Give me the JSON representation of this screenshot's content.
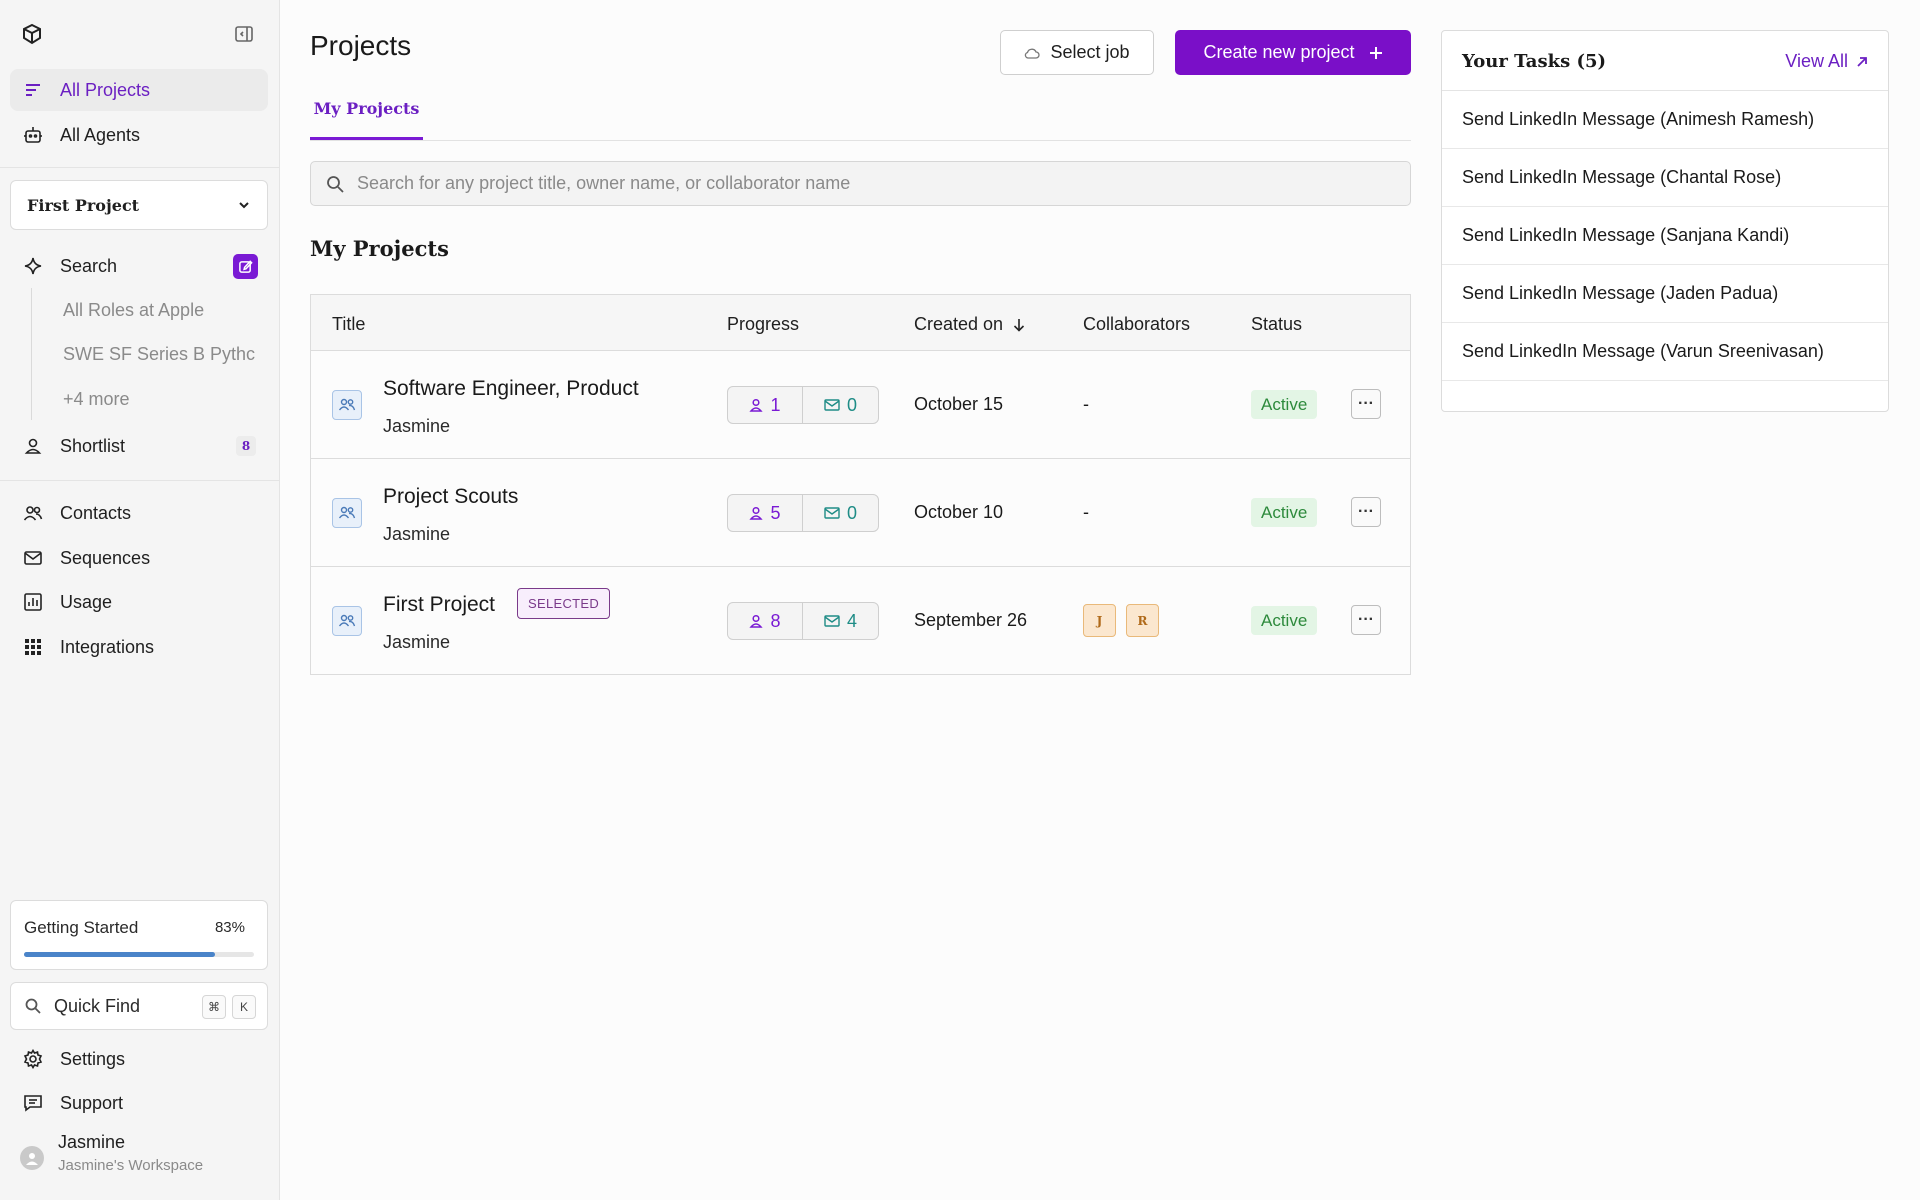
{
  "sidebar": {
    "nav_top": [
      {
        "label": "All Projects",
        "icon": "list-icon"
      },
      {
        "label": "All Agents",
        "icon": "robot-icon"
      }
    ],
    "project_select": "First Project",
    "search_label": "Search",
    "search_subitems": [
      "All Roles at Apple",
      "SWE SF Series B Pythc",
      "+4 more"
    ],
    "shortlist_label": "Shortlist",
    "shortlist_count": "8",
    "nav_mid": [
      {
        "label": "Contacts",
        "icon": "contacts-icon"
      },
      {
        "label": "Sequences",
        "icon": "mail-icon"
      },
      {
        "label": "Usage",
        "icon": "chart-icon"
      },
      {
        "label": "Integrations",
        "icon": "grid-icon"
      }
    ],
    "getting_started": {
      "label": "Getting Started",
      "percent_text": "83%",
      "progress": 0.83
    },
    "quick_find": {
      "label": "Quick Find",
      "keys": [
        "⌘",
        "K"
      ]
    },
    "nav_bottom": [
      {
        "label": "Settings",
        "icon": "gear-icon"
      },
      {
        "label": "Support",
        "icon": "chat-icon"
      }
    ],
    "user": {
      "name": "Jasmine",
      "workspace": "Jasmine's Workspace"
    }
  },
  "header": {
    "title": "Projects",
    "select_job_label": "Select job",
    "create_label": "Create new project"
  },
  "tabs": [
    "My Projects"
  ],
  "search": {
    "placeholder": "Search for any project title, owner name, or collaborator name"
  },
  "section_title": "My Projects",
  "table": {
    "columns": [
      "Title",
      "Progress",
      "Created on",
      "Collaborators",
      "Status"
    ],
    "rows": [
      {
        "title": "Software Engineer, Product",
        "owner": "Jasmine",
        "selected": "",
        "people": "1",
        "emails": "0",
        "created": "October 15",
        "collaborators": "-",
        "status": "Active"
      },
      {
        "title": "Project Scouts",
        "owner": "Jasmine",
        "selected": "",
        "people": "5",
        "emails": "0",
        "created": "October 10",
        "collaborators": "-",
        "status": "Active"
      },
      {
        "title": "First Project",
        "owner": "Jasmine",
        "selected": "SELECTED",
        "people": "8",
        "emails": "4",
        "created": "September 26",
        "collaborators": "",
        "collab_chips": [
          "J",
          "R"
        ],
        "status": "Active"
      }
    ]
  },
  "tasks": {
    "title": "Your Tasks (5)",
    "view_all": "View All",
    "items": [
      "Send LinkedIn Message (Animesh Ramesh)",
      "Send LinkedIn Message (Chantal Rose)",
      "Send LinkedIn Message (Sanjana Kandi)",
      "Send LinkedIn Message (Jaden Padua)",
      "Send LinkedIn Message (Varun Sreenivasan)"
    ]
  },
  "colors": {
    "accent": "#7a0fc8",
    "status_active": "#2d8a3c",
    "progress_fill": "#4a84c9"
  }
}
